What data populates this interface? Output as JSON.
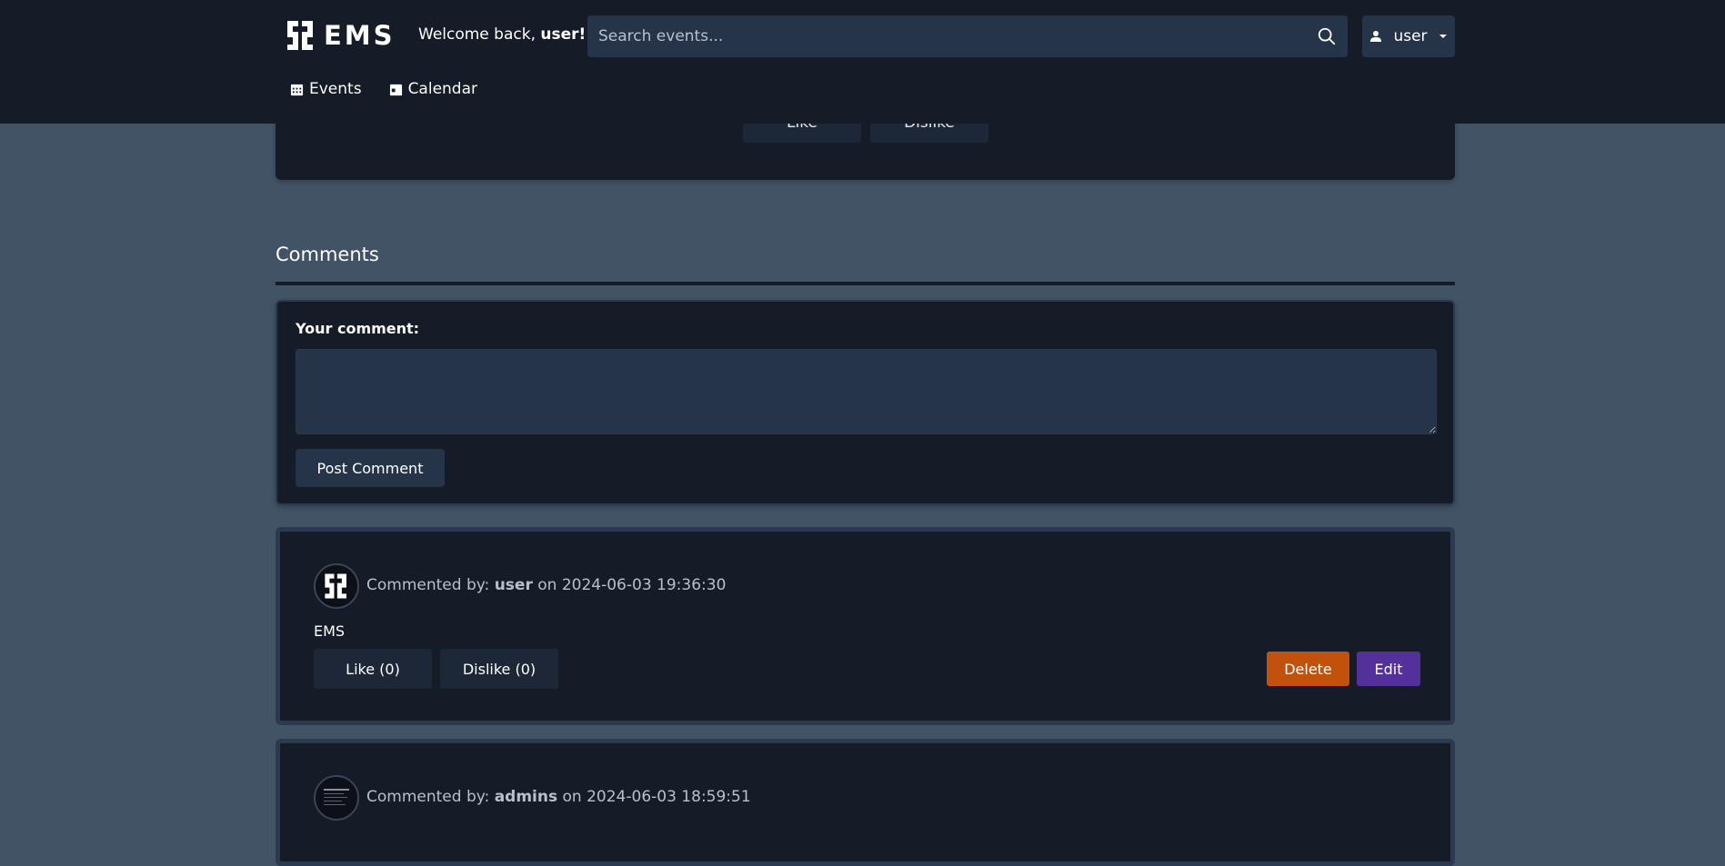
{
  "header": {
    "logo_text": "EMS",
    "welcome_prefix": "Welcome back,",
    "welcome_user": "user!",
    "search_placeholder": "Search events...",
    "user_menu_label": "user",
    "nav": [
      {
        "label": "Events",
        "icon": "calendar-grid-icon"
      },
      {
        "label": "Calendar",
        "icon": "calendar-icon"
      }
    ]
  },
  "event": {
    "like_label": "Like",
    "dislike_label": "Dislike"
  },
  "comments_section": {
    "title": "Comments",
    "form_label": "Your comment:",
    "textarea_value": "",
    "post_button": "Post Comment"
  },
  "comments": [
    {
      "prefix": "Commented by:",
      "author": "user",
      "on": "on",
      "timestamp": "2024-06-03 19:36:30",
      "text": "EMS",
      "like_label": "Like (0)",
      "dislike_label": "Dislike (0)",
      "delete_label": "Delete",
      "edit_label": "Edit"
    },
    {
      "prefix": "Commented by:",
      "author": "admins",
      "on": "on",
      "timestamp": "2024-06-03 18:59:51"
    }
  ],
  "colors": {
    "page_bg": "#425366",
    "card_bg": "#151b27",
    "input_bg": "#26344a",
    "delete": "#c2520b",
    "edit": "#54309a"
  }
}
